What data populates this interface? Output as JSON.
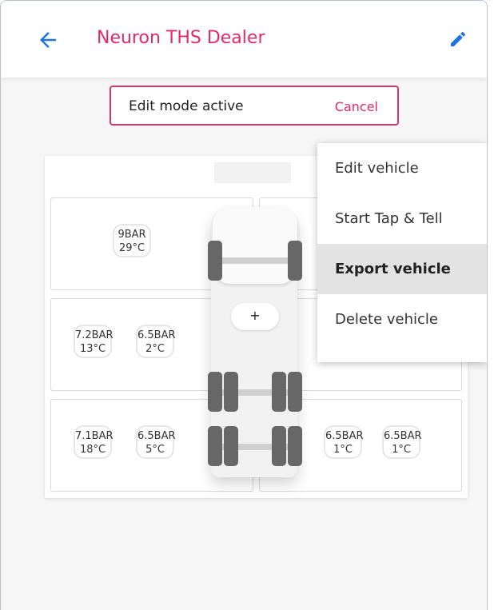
{
  "header": {
    "title": "Neuron THS Dealer",
    "back_icon": "arrow-left-icon",
    "edit_icon": "pencil-icon",
    "accent": "#1e74e6",
    "brand": "#e32a6a"
  },
  "edit_banner": {
    "message": "Edit mode active",
    "cancel": "Cancel"
  },
  "tires": {
    "row1_left": {
      "pressure": "9BAR",
      "temp": "29°C"
    },
    "row2_left_a": {
      "pressure": "7.2BAR",
      "temp": "13°C"
    },
    "row2_left_b": {
      "pressure": "6.5BAR",
      "temp": "2°C"
    },
    "row3_left_a": {
      "pressure": "7.1BAR",
      "temp": "18°C"
    },
    "row3_left_b": {
      "pressure": "6.5BAR",
      "temp": "5°C"
    },
    "row3_right_a": {
      "pressure": "6.5BAR",
      "temp": "1°C"
    },
    "row3_right_b": {
      "pressure": "6.5BAR",
      "temp": "1°C"
    }
  },
  "vehicle": {
    "add_label": "+"
  },
  "context_menu": {
    "items": [
      "Edit vehicle",
      "Start Tap & Tell",
      "Export vehicle",
      "Delete vehicle"
    ],
    "active_index": 2
  }
}
